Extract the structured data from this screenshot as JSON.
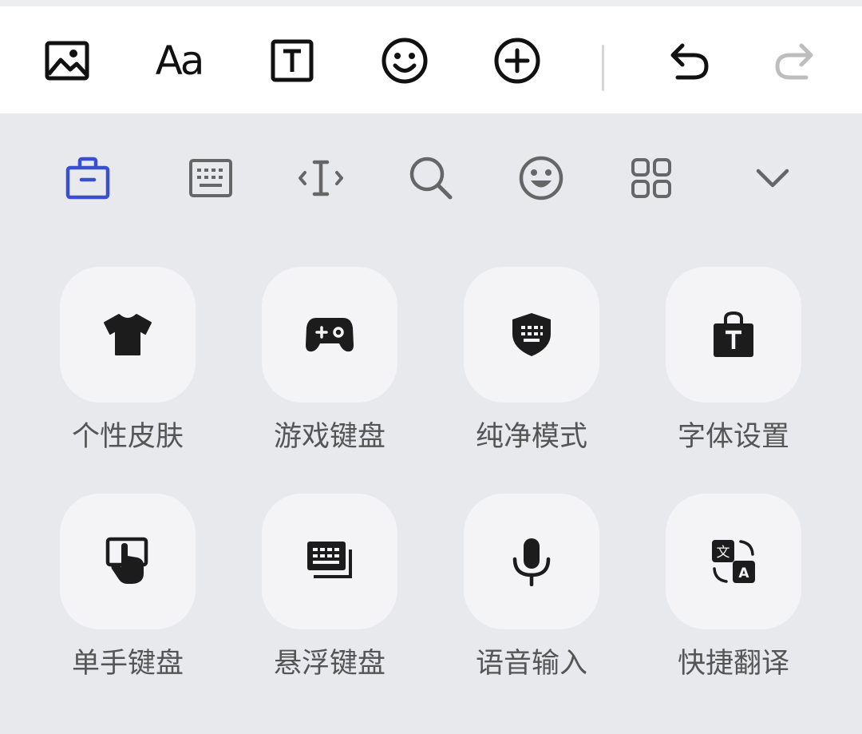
{
  "toolbar": {
    "buttons": [
      {
        "icon": "image-icon"
      },
      {
        "icon": "font-style-icon",
        "label": "Aa"
      },
      {
        "icon": "text-box-icon"
      },
      {
        "icon": "emoji-icon"
      },
      {
        "icon": "add-circle-icon"
      },
      {
        "icon": "undo-icon"
      },
      {
        "icon": "redo-icon",
        "state": "disabled"
      }
    ]
  },
  "keyboard_tabs": {
    "active_index": 0,
    "accent_color": "#3a4fd0",
    "items": [
      {
        "icon": "toolbox-icon"
      },
      {
        "icon": "keyboard-icon"
      },
      {
        "icon": "cursor-move-icon"
      },
      {
        "icon": "search-icon"
      },
      {
        "icon": "emoji-icon"
      },
      {
        "icon": "grid-icon"
      },
      {
        "icon": "chevron-down-icon"
      }
    ]
  },
  "features": [
    {
      "label": "个性皮肤",
      "icon": "tshirt-icon"
    },
    {
      "label": "游戏键盘",
      "icon": "gamepad-icon"
    },
    {
      "label": "纯净模式",
      "icon": "shield-keyboard-icon"
    },
    {
      "label": "字体设置",
      "icon": "font-bag-icon"
    },
    {
      "label": "单手键盘",
      "icon": "one-hand-icon"
    },
    {
      "label": "悬浮键盘",
      "icon": "floating-keyboard-icon"
    },
    {
      "label": "语音输入",
      "icon": "microphone-icon"
    },
    {
      "label": "快捷翻译",
      "icon": "translate-icon"
    }
  ]
}
